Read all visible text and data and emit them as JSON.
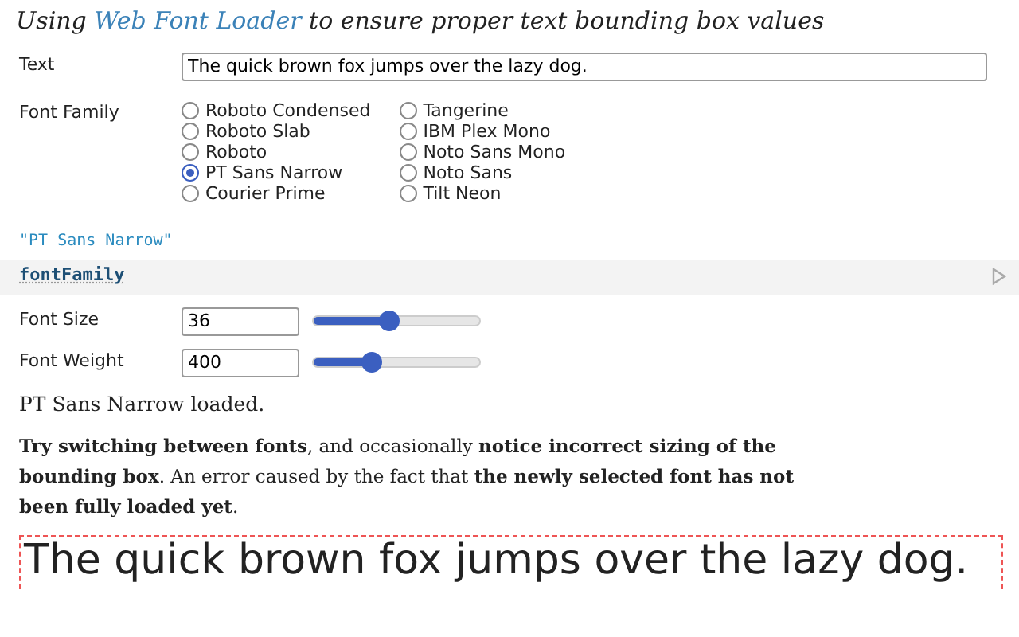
{
  "heading": {
    "before": "Using ",
    "link": "Web Font Loader",
    "after": " to ensure proper text bounding box values"
  },
  "text_field": {
    "label": "Text",
    "value": "The quick brown fox jumps over the lazy dog."
  },
  "font_family": {
    "label": "Font Family",
    "options": [
      {
        "label": "Roboto Condensed",
        "selected": false
      },
      {
        "label": "Roboto Slab",
        "selected": false
      },
      {
        "label": "Roboto",
        "selected": false
      },
      {
        "label": "PT Sans Narrow",
        "selected": true
      },
      {
        "label": "Courier Prime",
        "selected": false
      },
      {
        "label": "Tangerine",
        "selected": false
      },
      {
        "label": "IBM Plex Mono",
        "selected": false
      },
      {
        "label": "Noto Sans Mono",
        "selected": false
      },
      {
        "label": "Noto Sans",
        "selected": false
      },
      {
        "label": "Tilt Neon",
        "selected": false
      }
    ]
  },
  "value_output": "\"PT Sans Narrow\"",
  "cell_name": "fontFamily",
  "sliders": [
    {
      "label": "Font Size",
      "value": "36",
      "level": 0.45
    },
    {
      "label": "Font Weight",
      "value": "400",
      "level": 0.35
    }
  ],
  "status": "PT Sans Narrow loaded.",
  "note": "**Try switching between fonts**, and occasionally **notice incorrect sizing of the bounding box**. An error caused by the fact that **the newly selected font has not been fully loaded yet**.",
  "sample": {
    "text": "The quick brown fox jumps over the lazy dog."
  }
}
